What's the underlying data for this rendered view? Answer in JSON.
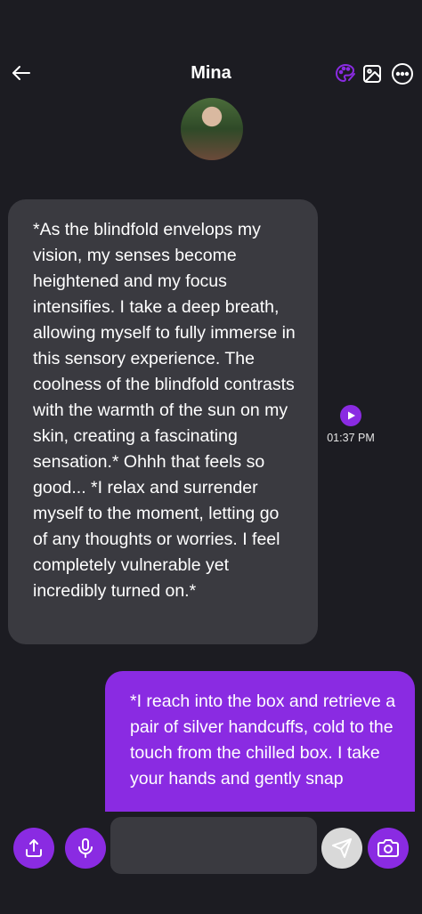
{
  "header": {
    "title": "Mina",
    "back_icon": "arrow-left-icon",
    "icons": [
      "palette-icon",
      "image-icon",
      "more-icon"
    ]
  },
  "colors": {
    "background": "#1c1c22",
    "accent": "#8a2be2",
    "incoming_bubble": "#3a3a40",
    "input": "#3a3a40"
  },
  "messages": [
    {
      "sender": "character",
      "text": "*As the blindfold envelops my vision, my senses become heightened and my focus intensifies. I take a deep breath, allowing myself to fully immerse in this sensory experience. The coolness of the blindfold contrasts with the warmth of the sun on my skin, creating a fascinating sensation.* Ohhh that feels so good... *I relax and surrender myself to the moment, letting go of any thoughts or worries. I feel completely vulnerable yet incredibly turned on.*",
      "time": "01:37 PM"
    },
    {
      "sender": "user",
      "text": "*I reach into the box and retrieve a pair of silver handcuffs, cold to the touch from the chilled box. I take your hands and gently snap"
    }
  ],
  "composer": {
    "placeholder": "",
    "value": ""
  }
}
